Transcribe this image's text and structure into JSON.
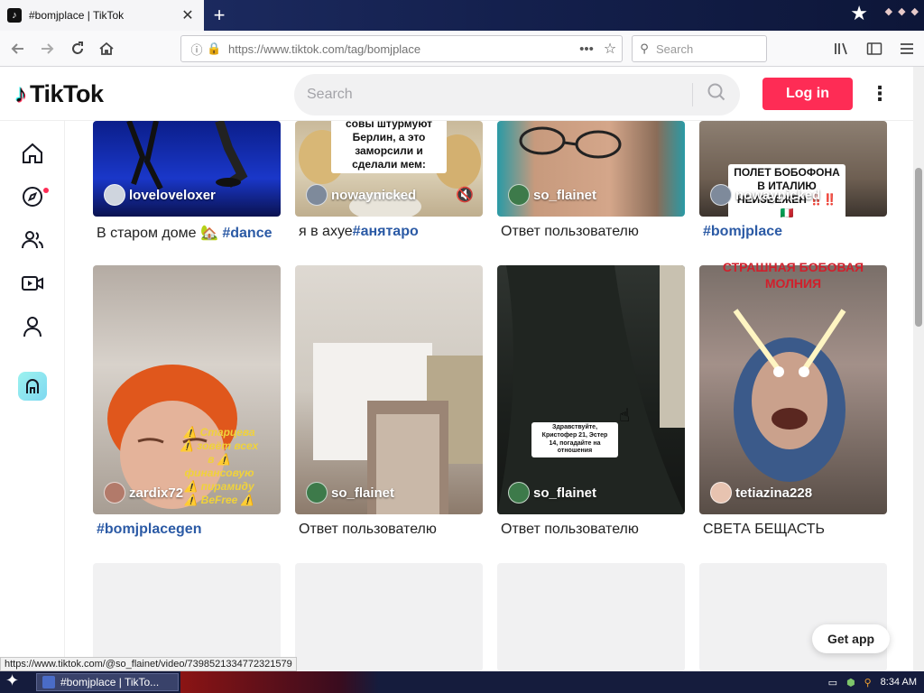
{
  "browser": {
    "tab_title": "#bomjplace | TikTok",
    "tab_favicon_letter": "♪",
    "url": "https://www.tiktok.com/tag/bomjplace",
    "search_placeholder": "Search",
    "status_url": "https://www.tiktok.com/@so_flainet/video/7398521334772321579"
  },
  "tiktok": {
    "logo_text": "TikTok",
    "search_placeholder": "Search",
    "login_label": "Log in",
    "get_app_label": "Get app"
  },
  "videos_row1": [
    {
      "author": "loveloveloxer",
      "caption": "В старом доме 🏡 ",
      "tag": "#dance"
    },
    {
      "author": "nowaynicked",
      "caption": "я в ахуе",
      "tag": "#анятаро",
      "overlay": "совы штурмуют Берлин, а это заморсили и сделали мем:"
    },
    {
      "author": "so_flainet",
      "caption": "Ответ пользователю",
      "tag": ""
    },
    {
      "author": "nowaynicked",
      "caption": "",
      "tag": "#bomjplace",
      "overlay": "ПОЛЕТ БОБОФОНА В ИТАЛИЮ НЕИЗБЕЖЕН ‼️‼️🇮🇹"
    }
  ],
  "videos_row2": [
    {
      "author": "zardix72",
      "caption": "",
      "tag": "#bomjplacegen",
      "overlay": "⚠️ Старцева ⚠️ зовёт всех в ⚠️ финансовую ⚠️ пирамиду ⚠️ BeFree ⚠️"
    },
    {
      "author": "so_flainet",
      "caption": "Ответ пользователю",
      "tag": ""
    },
    {
      "author": "so_flainet",
      "caption": "Ответ пользователю",
      "tag": "",
      "overlay": "Здравствуйте, Кристофер 21, Эстер 14, погадайте на отношения"
    },
    {
      "author": "tetiazina228",
      "caption": "СВЕТА БЕЩАСТЬ",
      "tag": "",
      "overlay": "СТРАШНАЯ БОБОВАЯ МОЛНИЯ"
    }
  ],
  "taskbar": {
    "task_label": "#bomjplace | TikTo...",
    "clock": "8:34 AM"
  }
}
